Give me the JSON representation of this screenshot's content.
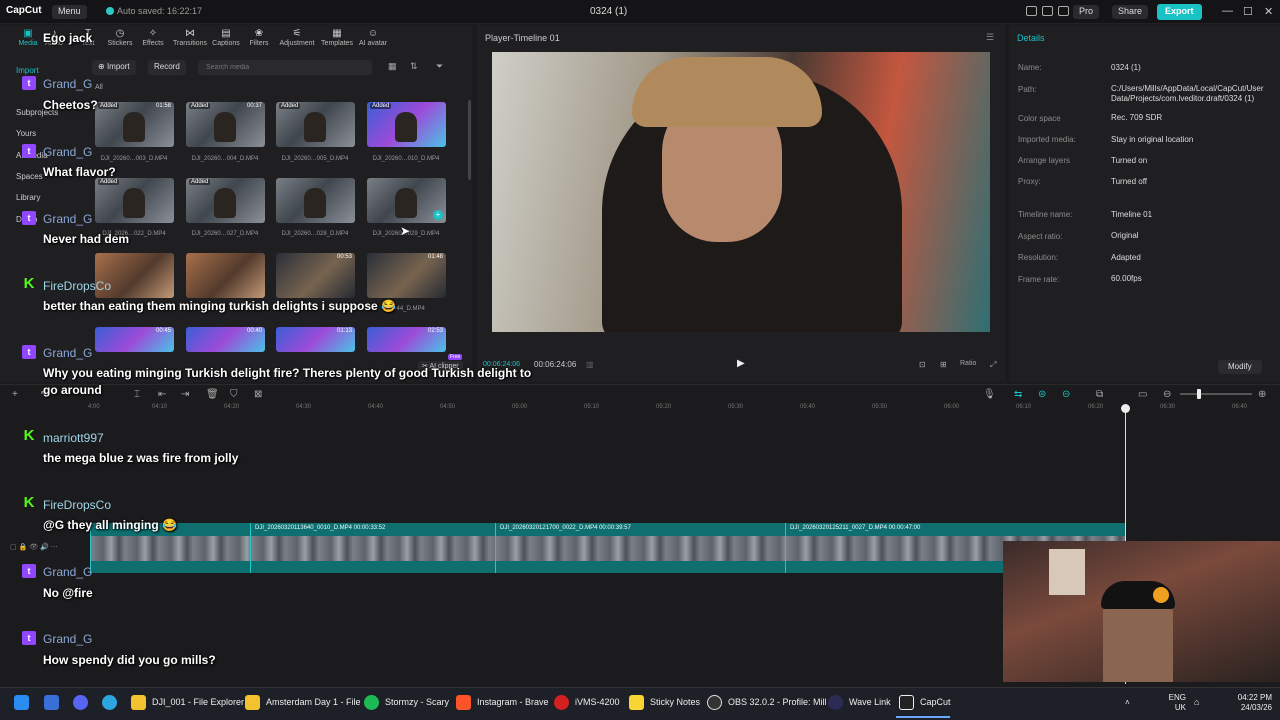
{
  "titlebar": {
    "app": "CapCut",
    "menu": "Menu",
    "autosave": "Auto saved: 16:22:17",
    "title": "0324 (1)",
    "pro": "Pro",
    "share": "Share",
    "export": "Export"
  },
  "media": {
    "tabs": [
      "Media",
      "Audio",
      "Text",
      "Stickers",
      "Effects",
      "Transitions",
      "Captions",
      "Filters",
      "Adjustment",
      "Templates",
      "AI avatar"
    ],
    "sidebar": [
      "Import",
      "Subprojects",
      "Yours",
      "AI media",
      "Spaces",
      "Library",
      "Demo"
    ],
    "import_btn": "Import",
    "record_btn": "Record",
    "search_placeholder": "Search media",
    "filter_all": "All",
    "thumbs": [
      {
        "cap": "DJI_20260…003_D.MP4",
        "dur": "01:58",
        "added": "Added"
      },
      {
        "cap": "DJI_20260…004_D.MP4",
        "dur": "00:37",
        "added": "Added"
      },
      {
        "cap": "DJI_20260…005_D.MP4",
        "dur": "",
        "added": "Added"
      },
      {
        "cap": "DJI_20260…010_D.MP4",
        "dur": "",
        "added": "Added"
      },
      {
        "cap": "DJI_2026…022_D.MP4",
        "dur": "",
        "added": "Added"
      },
      {
        "cap": "DJI_20260…027_D.MP4",
        "dur": "",
        "added": "Added"
      },
      {
        "cap": "DJI_20260…028_D.MP4",
        "dur": "",
        "added": ""
      },
      {
        "cap": "DJI_20260…029_D.MP4",
        "dur": "",
        "added": ""
      },
      {
        "cap": "",
        "dur": "",
        "added": ""
      },
      {
        "cap": "",
        "dur": "",
        "added": ""
      },
      {
        "cap": "",
        "dur": "00:53",
        "added": ""
      },
      {
        "cap": "…044_D.MP4",
        "dur": "01:48",
        "added": ""
      },
      {
        "cap": "",
        "dur": "00:45",
        "added": ""
      },
      {
        "cap": "",
        "dur": "00:40",
        "added": ""
      },
      {
        "cap": "",
        "dur": "01:13",
        "added": ""
      },
      {
        "cap": "",
        "dur": "02:53",
        "added": ""
      }
    ]
  },
  "player": {
    "title": "Player-Timeline 01",
    "current_time": "00:06:24:06",
    "total_time": "00:06:24:06",
    "ai_clipper": "AI clipper",
    "free_badge": "Free",
    "ratio": "Ratio"
  },
  "details": {
    "title": "Details",
    "rows": [
      {
        "label": "Name:",
        "value": "0324 (1)"
      },
      {
        "label": "Path:",
        "value": "C:/Users/Mills/AppData/Local/CapCut/User Data/Projects/com.lveditor.draft/0324 (1)"
      },
      {
        "label": "Color space",
        "value": "Rec. 709 SDR"
      },
      {
        "label": "Imported media:",
        "value": "Stay in original location"
      },
      {
        "label": "Arrange layers",
        "value": "Turned on"
      },
      {
        "label": "Proxy:",
        "value": "Turned off"
      },
      {
        "label": "Timeline name:",
        "value": "Timeline 01"
      },
      {
        "label": "Aspect ratio:",
        "value": "Original"
      },
      {
        "label": "Resolution:",
        "value": "Adapted"
      },
      {
        "label": "Frame rate:",
        "value": "60.00fps"
      }
    ],
    "modify": "Modify"
  },
  "timeline": {
    "ticks": [
      "4:00",
      "04:10",
      "04:20",
      "04:30",
      "04:40",
      "04:50",
      "05:00",
      "05:10",
      "05:20",
      "05:30",
      "05:40",
      "05:50",
      "06:00",
      "06:10",
      "06:20",
      "06:30",
      "06:40"
    ],
    "clips": [
      {
        "label": ""
      },
      {
        "label": "DJI_20260320113640_0010_D.MP4  00:00:33:52"
      },
      {
        "label": "DJI_20260320121700_0022_D.MP4  00:00:39:57"
      },
      {
        "label": "DJI_20260320125211_0027_D.MP4  00:00:47:00"
      }
    ]
  },
  "chat": [
    {
      "platform": "twitch",
      "name": "",
      "msg": "Ego jack"
    },
    {
      "platform": "twitch",
      "name": "Grand_G",
      "msg": "Cheetos?"
    },
    {
      "platform": "twitch",
      "name": "Grand_G",
      "msg": "What flavor?"
    },
    {
      "platform": "twitch",
      "name": "Grand_G",
      "msg": "Never had dem"
    },
    {
      "platform": "kick",
      "name": "FireDropsCo",
      "msg": "better than eating them minging turkish delights i suppose 😂"
    },
    {
      "platform": "twitch",
      "name": "Grand_G",
      "msg": "Why you eating minging Turkish delight fire? Theres plenty of good Turkish delight to go around"
    },
    {
      "platform": "kick",
      "name": "marriott997",
      "msg": "the mega blue z was fire from jolly"
    },
    {
      "platform": "kick",
      "name": "FireDropsCo",
      "msg": "@G they all minging 😂"
    },
    {
      "platform": "twitch",
      "name": "Grand_G",
      "msg": "No @fire"
    },
    {
      "platform": "twitch",
      "name": "Grand_G",
      "msg": "How spendy did you go mills?"
    }
  ],
  "taskbar": {
    "items": [
      "DJI_001 - File Explorer",
      "Amsterdam Day 1 - File",
      "Stormzy - Scary",
      "Instagram - Brave",
      "iVMS-4200",
      "Sticky Notes",
      "OBS 32.0.2 - Profile: Mill",
      "Wave Link",
      "CapCut"
    ],
    "lang1": "ENG",
    "lang2": "UK",
    "time": "04:22 PM",
    "date": "24/03/26"
  },
  "colors": {
    "accent": "#19c3c5",
    "twitch": "#9146ff",
    "kick": "#53fc18"
  }
}
